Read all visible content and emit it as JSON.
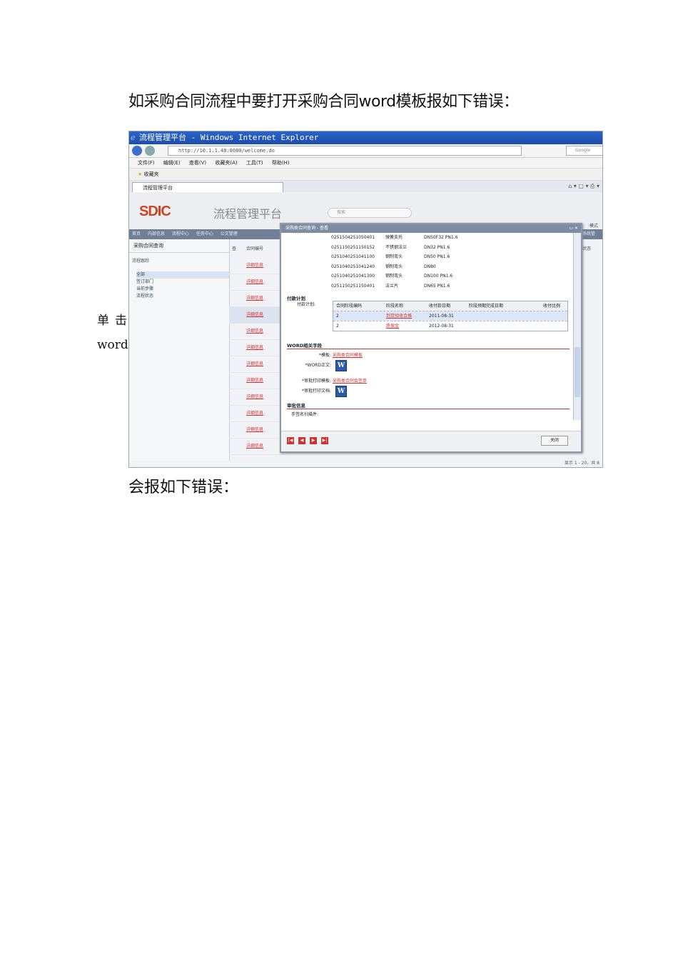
{
  "document": {
    "intro": "如采购合同流程中要打开采购合同word模板报如下错误：",
    "side_note_line1": "单击采购合同",
    "side_note_line2": "word 模板",
    "error_line": "会报如下错误："
  },
  "browser": {
    "title": "流程管理平台 - Windows Internet Explorer",
    "address": "http://10.1.1.48:8080/welcome.do",
    "search_placeholder": "Google",
    "menu": [
      "文件(F)",
      "编辑(E)",
      "查看(V)",
      "收藏夹(A)",
      "工具(T)",
      "帮助(H)"
    ],
    "favorites_label": "收藏夹",
    "tab_label": "流程管理平台"
  },
  "app": {
    "logo": "SDIC",
    "subtitle": "流程管理平台",
    "search_placeholder": "搜索",
    "nav": [
      "首页",
      "内部信息",
      "流程中心",
      "任务中心",
      "公文管理"
    ],
    "nav_right": "系统管",
    "mode_label": "模式",
    "left_header": "采购合同查询",
    "left_tool": "流程跟踪",
    "tree": [
      "全部",
      "签订部门",
      "当前步骤",
      "流程状态"
    ],
    "grid_headers": [
      "查",
      "合同编号"
    ],
    "detail_link": "详细信息",
    "grid_right_header": "状态",
    "status_text": "显示 1 - 20，共 8"
  },
  "dialog": {
    "title": "采购类合同查询 - 查看",
    "materials": [
      {
        "code": "0251504251050401",
        "name": "弹簧支托",
        "spec": "DN50F32 PN1.6"
      },
      {
        "code": "0251150251150152",
        "name": "不锈钢法兰",
        "spec": "DN32 PN1.6"
      },
      {
        "code": "0251040251041100",
        "name": "钢制弯头",
        "spec": "DN50 PN1.6"
      },
      {
        "code": "0251040251041240",
        "name": "钢制弯头",
        "spec": "DN80"
      },
      {
        "code": "0251040251041300",
        "name": "钢制弯头",
        "spec": "DN100 PN1.6"
      },
      {
        "code": "0251150251150401",
        "name": "法兰片",
        "spec": "DN65 PN1.6"
      }
    ],
    "payment_section": "付款计划",
    "payment_sub": "付款计划:",
    "payment_headers": [
      "合同阶段编码",
      "阶段名称",
      "收付款日期",
      "阶段预期完成日期",
      "收付比例"
    ],
    "payment_rows": [
      {
        "code": "2",
        "name": "到货验收合格",
        "date": "2011-08-31"
      },
      {
        "code": "2",
        "name": "质保金",
        "date": "2012-08-31"
      }
    ],
    "word_section": "WORD相关字段",
    "template_label": "*模板:",
    "template_link": "采购类合同模板",
    "word_body_label": "*WORD正文:",
    "approval_template_label": "*审批打印模板:",
    "approval_template_link": "采购类合同会签单",
    "approval_doc_label": "*审批打印文档:",
    "review_section": "审批信息",
    "signature_label": "手签名扫描件:",
    "close_button": "关闭"
  }
}
